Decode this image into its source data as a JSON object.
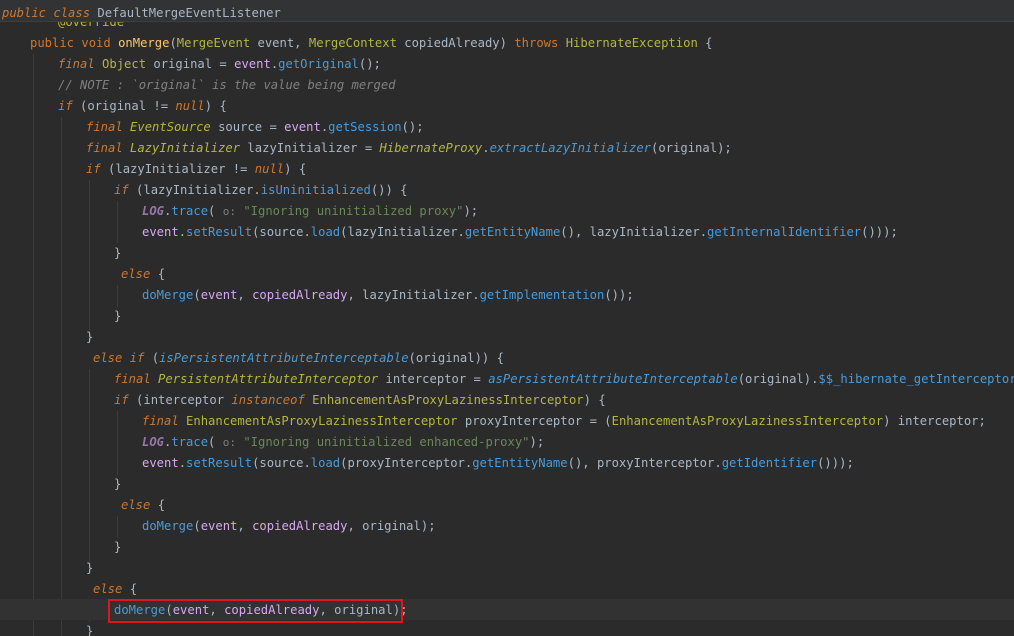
{
  "sticky_header": {
    "kw_public": "public",
    "kw_class": "class",
    "class_name": "DefaultMergeEventListener"
  },
  "lines": {
    "l0": "@Override",
    "l1": {
      "a": "public void ",
      "b": "onMerge",
      "c": "(",
      "d": "MergeEvent",
      "e": " event, ",
      "f": "MergeContext",
      "g": " copiedAlready) ",
      "h": "throws ",
      "i": "HibernateException",
      "j": " {"
    },
    "l2": {
      "a": "final ",
      "b": "Object",
      "c": " original = ",
      "d": "event",
      "e": ".",
      "f": "getOriginal",
      "g": "();"
    },
    "l3": "// NOTE : `original` is the value being merged",
    "l4": {
      "a": "if",
      "b": " (original != ",
      "c": "null",
      "d": ") {"
    },
    "l5": {
      "a": "final ",
      "b": "EventSource",
      "c": " source = ",
      "d": "event",
      "e": ".",
      "f": "getSession",
      "g": "();"
    },
    "l6": {
      "a": "final ",
      "b": "LazyInitializer",
      "c": " lazyInitializer = ",
      "d": "HibernateProxy",
      "e": ".",
      "f": "extractLazyInitializer",
      "g": "(original);"
    },
    "l7": {
      "a": "if",
      "b": " (lazyInitializer != ",
      "c": "null",
      "d": ") {"
    },
    "l8": {
      "a": "if",
      "b": " (lazyInitializer.",
      "c": "isUninitialized",
      "d": "()) {"
    },
    "l9": {
      "a": "LOG",
      "b": ".",
      "c": "trace",
      "d": "( ",
      "e": "o:",
      "f": " ",
      "g": "\"Ignoring uninitialized proxy\"",
      "h": ");"
    },
    "l10": {
      "a": "event",
      "b": ".",
      "c": "setResult",
      "d": "(source.",
      "e": "load",
      "f": "(lazyInitializer.",
      "g": "getEntityName",
      "h": "(), lazyInitializer.",
      "i": "getInternalIdentifier",
      "j": "()));"
    },
    "l11": "}",
    "l12": {
      "a": "else",
      "b": " {"
    },
    "l13": {
      "a": "doMerge",
      "b": "(",
      "c": "event",
      "d": ", ",
      "e": "copiedAlready",
      "f": ", lazyInitializer.",
      "g": "getImplementation",
      "h": "());"
    },
    "l14": "}",
    "l15": "}",
    "l16": {
      "a": "else if",
      "b": " (",
      "c": "isPersistentAttributeInterceptable",
      "d": "(original)) {"
    },
    "l17": {
      "a": "final ",
      "b": "PersistentAttributeInterceptor",
      "c": " interceptor = ",
      "d": "asPersistentAttributeInterceptable",
      "e": "(original).",
      "f": "$$_hibernate_getInterceptor",
      "g": "();"
    },
    "l18": {
      "a": "if",
      "b": " (interceptor ",
      "c": "instanceof",
      "d": " ",
      "e": "EnhancementAsProxyLazinessInterceptor",
      "f": ") {"
    },
    "l19": {
      "a": "final ",
      "b": "EnhancementAsProxyLazinessInterceptor",
      "c": " proxyInterceptor = (",
      "d": "EnhancementAsProxyLazinessInterceptor",
      "e": ") interceptor;"
    },
    "l20": {
      "a": "LOG",
      "b": ".",
      "c": "trace",
      "d": "( ",
      "e": "o:",
      "f": " ",
      "g": "\"Ignoring uninitialized enhanced-proxy\"",
      "h": ");"
    },
    "l21": {
      "a": "event",
      "b": ".",
      "c": "setResult",
      "d": "(source.",
      "e": "load",
      "f": "(proxyInterceptor.",
      "g": "getEntityName",
      "h": "(), proxyInterceptor.",
      "i": "getIdentifier",
      "j": "()));"
    },
    "l22": "}",
    "l23": {
      "a": "else",
      "b": " {"
    },
    "l24": {
      "a": "doMerge",
      "b": "(",
      "c": "event",
      "d": ", ",
      "e": "copiedAlready",
      "f": ", original);"
    },
    "l25": "}",
    "l26": "}",
    "l27": {
      "a": "else",
      "b": " {"
    },
    "l28": {
      "a": "doMerge",
      "b": "(",
      "c": "event",
      "d": ", ",
      "e": "copiedAlready",
      "f": ", original);"
    },
    "l29": "}"
  },
  "colors": {
    "background": "#2b2b2b",
    "keyword": "#cc7832",
    "method": "#4a9bd8",
    "string": "#6a8759",
    "comment": "#808080",
    "highlight_box": "#e0161d"
  }
}
